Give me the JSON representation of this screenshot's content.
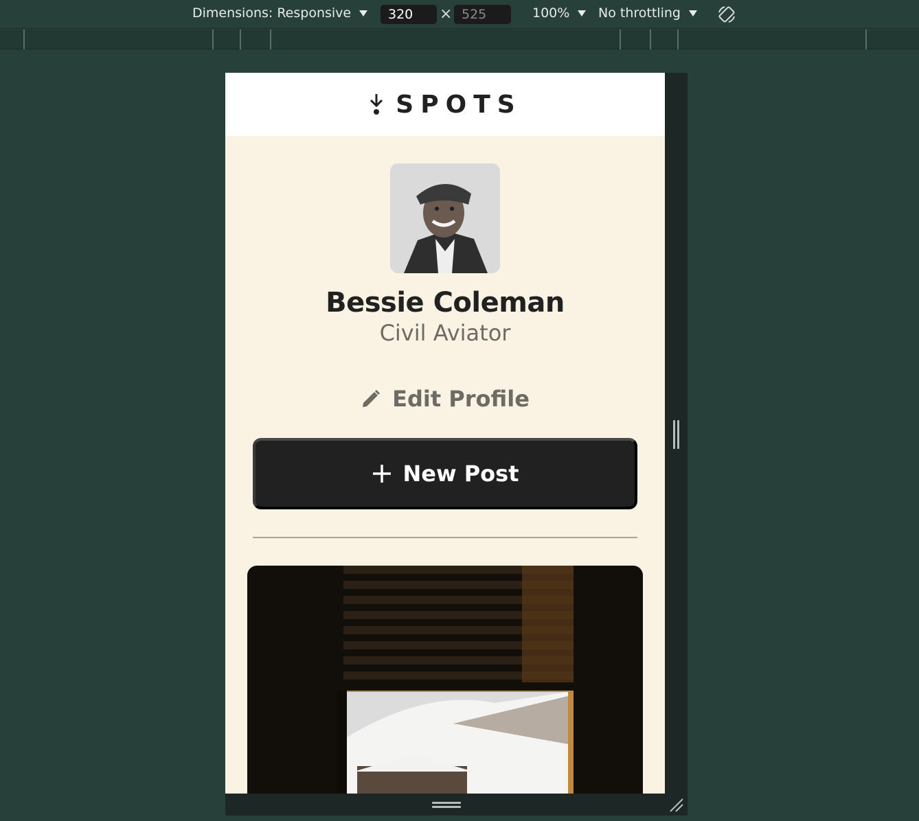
{
  "devtools": {
    "dimensions_label": "Dimensions: Responsive",
    "width_value": "320",
    "height_value": "525",
    "times_symbol": "×",
    "zoom": "100%",
    "throttling": "No throttling"
  },
  "app": {
    "logo_text": "SPOTS",
    "profile": {
      "name": "Bessie Coleman",
      "role": "Civil Aviator",
      "edit_label": "Edit Profile",
      "new_post_label": "New Post"
    }
  }
}
